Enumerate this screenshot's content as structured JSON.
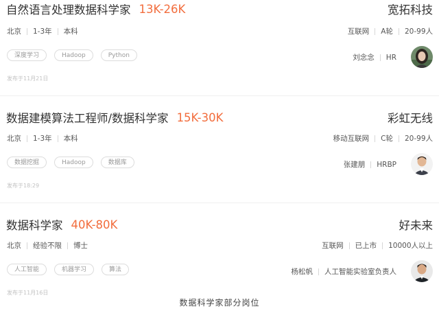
{
  "jobs": [
    {
      "title": "自然语言处理数据科学家",
      "salary": "13K-26K",
      "city": "北京",
      "experience": "1-3年",
      "education": "本科",
      "tags": [
        "深度学习",
        "Hadoop",
        "Python"
      ],
      "post_time": "发布于11月21日",
      "company": {
        "name": "宽拓科技",
        "industry": "互联网",
        "stage": "A轮",
        "size": "20-99人"
      },
      "recruiter": {
        "name": "刘念念",
        "role": "HR",
        "avatar_icon": "avatar-photo-woman"
      }
    },
    {
      "title": "数据建模算法工程师/数据科学家",
      "salary": "15K-30K",
      "city": "北京",
      "experience": "1-3年",
      "education": "本科",
      "tags": [
        "数据挖掘",
        "Hadoop",
        "数据库"
      ],
      "post_time": "发布于18:29",
      "company": {
        "name": "彩虹无线",
        "industry": "移动互联网",
        "stage": "C轮",
        "size": "20-99人"
      },
      "recruiter": {
        "name": "张建朋",
        "role": "HRBP",
        "avatar_icon": "avatar-photo-man"
      }
    },
    {
      "title": "数据科学家",
      "salary": "40K-80K",
      "city": "北京",
      "experience": "经验不限",
      "education": "博士",
      "tags": [
        "人工智能",
        "机器学习",
        "算法"
      ],
      "post_time": "发布于11月16日",
      "company": {
        "name": "好未来",
        "industry": "互联网",
        "stage": "已上市",
        "size": "10000人以上"
      },
      "recruiter": {
        "name": "杨松帆",
        "role": "人工智能实验室负责人",
        "avatar_icon": "avatar-photo-man"
      }
    }
  ],
  "caption": "数据科学家部分岗位",
  "colors": {
    "salary": "#f26d3d",
    "tag_border": "#dcdcdc",
    "muted": "#c2c2c2"
  }
}
